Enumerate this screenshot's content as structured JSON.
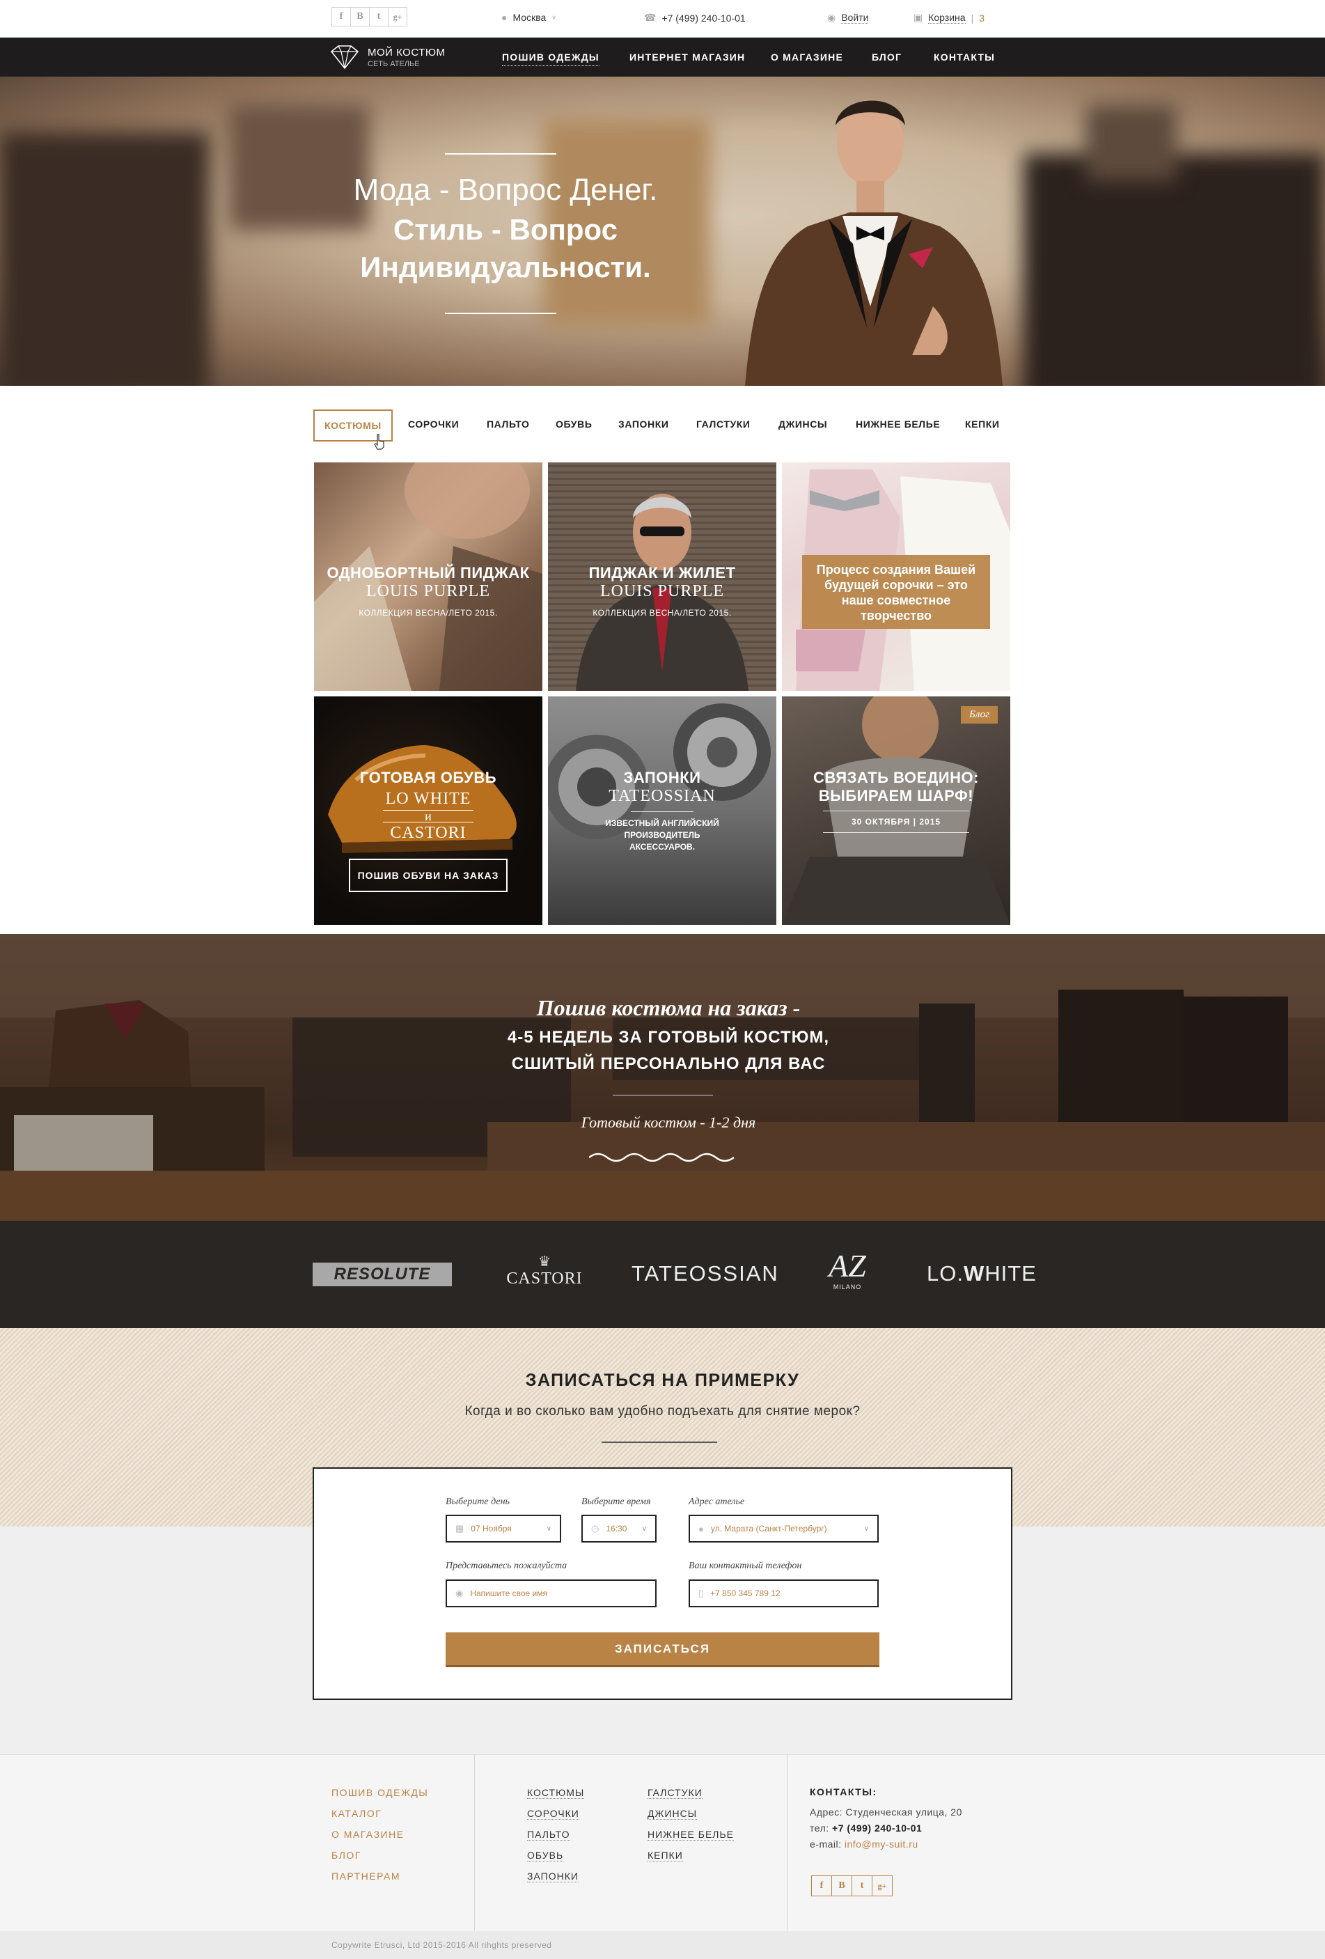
{
  "topbar": {
    "social": [
      {
        "icon": "facebook-icon",
        "glyph": "f"
      },
      {
        "icon": "vkontakte-icon",
        "glyph": "В"
      },
      {
        "icon": "twitter-icon",
        "glyph": "t"
      },
      {
        "icon": "googleplus-icon",
        "glyph": "g+"
      }
    ],
    "city": "Москва",
    "phone": "+7 (499) 240-10-01",
    "login": "Войти",
    "cart": "Корзина",
    "cart_count": "3"
  },
  "nav": {
    "logo_title": "МОЙ КОСТЮМ",
    "logo_sub": "СЕТЬ АТЕЛЬЕ",
    "items": [
      "ПОШИВ ОДЕЖДЫ",
      "ИНТЕРНЕТ МАГАЗИН",
      "О МАГАЗИНЕ",
      "БЛОГ",
      "КОНТАКТЫ"
    ]
  },
  "hero": {
    "line1": "Мода - Вопрос Денег.",
    "line2": "Стиль - Вопрос",
    "line3": "Индивидуальности."
  },
  "categories": [
    "КОСТЮМЫ",
    "СОРОЧКИ",
    "ПАЛЬТО",
    "ОБУВЬ",
    "ЗАПОНКИ",
    "ГАЛСТУКИ",
    "ДЖИНСЫ",
    "НИЖНЕЕ БЕЛЬЕ",
    "КЕПКИ"
  ],
  "tiles": {
    "t1": {
      "title": "ОДНОБОРТНЫЙ ПИДЖАК",
      "brand": "LOUIS PURPLE",
      "meta": "КОЛЛЕКЦИЯ ВЕСНА/ЛЕТО 2015."
    },
    "t2": {
      "title": "ПИДЖАК И ЖИЛЕТ",
      "brand": "LOUIS PURPLE",
      "meta": "КОЛЛЕКЦИЯ ВЕСНА/ЛЕТО 2015."
    },
    "t3": {
      "text": "Процесс создания Вашей будущей сорочки – это наше совместное творчество"
    },
    "t4": {
      "title": "ГОТОВАЯ ОБУВЬ",
      "brand1": "LO WHITE",
      "and": "и",
      "brand2": "CASTORI",
      "button": "ПОШИВ ОБУВИ НА ЗАКАЗ"
    },
    "t5": {
      "title": "ЗАПОНКИ",
      "brand": "TATEOSSIAN",
      "meta1": "ИЗВЕСТНЫЙ АНГЛИЙСКИЙ",
      "meta2": "ПРОИЗВОДИТЕЛЬ",
      "meta3": "АКСЕССУАРОВ."
    },
    "t6": {
      "badge": "Блог",
      "title1": "СВЯЗАТЬ ВОЕДИНО:",
      "title2": "ВЫБИРАЕМ ШАРФ!",
      "date": "30 ОКТЯБРЯ | 2015"
    }
  },
  "showroom": {
    "line1": "Пошив костюма на заказ -",
    "line2": "4-5 НЕДЕЛЬ ЗА ГОТОВЫЙ КОСТЮМ,",
    "line3": "СШИТЫЙ ПЕРСОНАЛЬНО ДЛЯ ВАС",
    "line4": "Готовый костюм - 1-2 дня"
  },
  "brands": {
    "resolute": "RESOLUTE",
    "castori": "CASTORI",
    "tateossian": "TATEOSSIAN",
    "milano_mark": "AZ",
    "milano": "MILANO",
    "lowhite_a": "LO.",
    "lowhite_b": "W",
    "lowhite_c": "HITE"
  },
  "booking": {
    "title": "ЗАПИСАТЬСЯ НА ПРИМЕРКУ",
    "subtitle": "Когда и во сколько вам удобно подъехать для снятие мерок?",
    "day_label": "Выберите день",
    "day_value": "07 Ноября",
    "time_label": "Выберите время",
    "time_value": "16:30",
    "address_label": "Адрес ателье",
    "address_value": "ул. Марата (Санкт-Петербург)",
    "name_label": "Представьтесь пожалуйста",
    "name_placeholder": "Напишите свое имя",
    "phone_label": "Ваш контактный телефон",
    "phone_placeholder": "+7 850 345 789 12",
    "submit": "ЗАПИСАТЬСЯ"
  },
  "footer": {
    "col1": [
      "ПОШИВ ОДЕЖДЫ",
      "КАТАЛОГ",
      "О МАГАЗИНЕ",
      "БЛОГ",
      "ПАРТНЕРАМ"
    ],
    "col2": [
      "КОСТЮМЫ",
      "СОРОЧКИ",
      "ПАЛЬТО",
      "ОБУВЬ",
      "ЗАПОНКИ"
    ],
    "col3": [
      "ГАЛСТУКИ",
      "ДЖИНСЫ",
      "НИЖНЕЕ БЕЛЬЕ",
      "КЕПКИ"
    ],
    "contacts_title": "КОНТАКТЫ:",
    "address_label": "Адрес:",
    "address": "Студенческая улица, 20",
    "phone_label": "тел:",
    "phone": "+7 (499) 240-10-01",
    "email_label": "e-mail:",
    "email": "info@my-suit.ru",
    "copyright": "Copywrite Etrusci, Ltd 2015-2016 All rihghts preserved"
  },
  "colors": {
    "accent": "#b98346",
    "nav_bg": "#1e1c1c",
    "brands_bg": "#2a2624"
  }
}
